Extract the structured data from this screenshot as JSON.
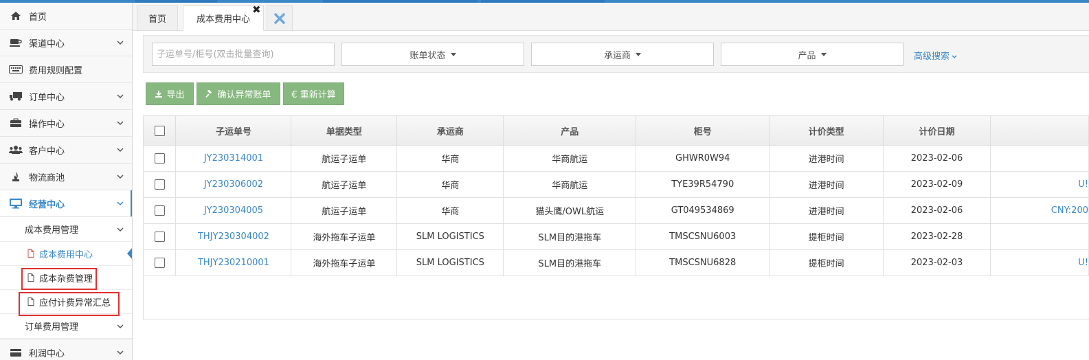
{
  "sidebar": {
    "items": [
      {
        "label": "首页",
        "icon": "home-icon"
      },
      {
        "label": "渠道中心",
        "icon": "coffee-icon"
      },
      {
        "label": "费用规则配置",
        "icon": "keyboard-icon"
      },
      {
        "label": "订单中心",
        "icon": "truck-icon"
      },
      {
        "label": "操作中心",
        "icon": "briefcase-icon"
      },
      {
        "label": "客户中心",
        "icon": "users-icon"
      },
      {
        "label": "物流商池",
        "icon": "fire-extinguisher-icon"
      },
      {
        "label": "经营中心",
        "icon": "desktop-icon"
      }
    ],
    "submenu": {
      "title": "成本费用管理",
      "items": [
        "成本费用中心",
        "成本杂费管理",
        "应付计费异常汇总"
      ]
    },
    "order_fee": "订单费用管理",
    "profit": "利润中心"
  },
  "tabs": {
    "home": "首页",
    "current": "成本费用中心",
    "close_symbol": "✖"
  },
  "search": {
    "placeholder": "子运单号/柜号(双击批量查询)",
    "bill_status": "账单状态",
    "carrier": "承运商",
    "product": "产品",
    "advanced": "高级搜索"
  },
  "toolbar": {
    "export": "导出",
    "confirm": "确认异常账单",
    "recalc": "€ 重新计算"
  },
  "table": {
    "headers": [
      "子运单号",
      "单据类型",
      "承运商",
      "产品",
      "柜号",
      "计价类型",
      "计价日期"
    ],
    "rows": [
      {
        "id": "JY230314001",
        "type": "航运子运单",
        "carrier": "华商",
        "product": "华商航运",
        "container": "GHWR0W94",
        "price_type": "进港时间",
        "date": "2023-02-06",
        "extra": ""
      },
      {
        "id": "JY230306002",
        "type": "航运子运单",
        "carrier": "华商",
        "product": "华商航运",
        "container": "TYE39R54790",
        "price_type": "进港时间",
        "date": "2023-02-09",
        "extra": "U!"
      },
      {
        "id": "JY230304005",
        "type": "航运子运单",
        "carrier": "华商",
        "product": "猫头鹰/OWL航运",
        "container": "GT049534869",
        "price_type": "进港时间",
        "date": "2023-02-06",
        "extra": "CNY:200"
      },
      {
        "id": "THJY230304002",
        "type": "海外拖车子运单",
        "carrier": "SLM LOGISTICS",
        "product": "SLM目的港拖车",
        "container": "TMSCSNU6003",
        "price_type": "提柜时间",
        "date": "2023-02-28",
        "extra": ""
      },
      {
        "id": "THJY230210001",
        "type": "海外拖车子运单",
        "carrier": "SLM LOGISTICS",
        "product": "SLM目的港拖车",
        "container": "TMSCSNU6828",
        "price_type": "提柜时间",
        "date": "2023-02-03",
        "extra": "U!"
      }
    ]
  }
}
